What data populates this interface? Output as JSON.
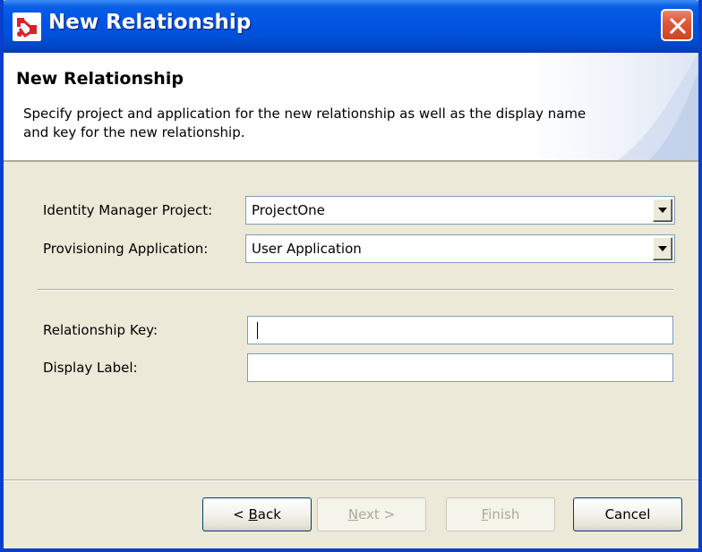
{
  "window": {
    "title": "New Relationship"
  },
  "banner": {
    "title": "New Relationship",
    "description": "Specify project and application for the new relationship as well as the display name and key for the new relationship."
  },
  "form": {
    "project_label": "Identity Manager Project:",
    "project_value": "ProjectOne",
    "application_label": "Provisioning Application:",
    "application_value": "User Application",
    "key_label": "Relationship Key:",
    "key_value": "",
    "display_label_label": "Display Label:",
    "display_label_value": ""
  },
  "buttons": {
    "back": {
      "pre": "< ",
      "mnemonic": "B",
      "rest": "ack"
    },
    "next": {
      "mnemonic": "N",
      "rest": "ext >"
    },
    "finish": {
      "mnemonic": "F",
      "rest": "inish"
    },
    "cancel": "Cancel"
  },
  "icons": {
    "app": "relationship-icon",
    "close": "close-icon",
    "dropdown": "dropdown-arrow-icon"
  },
  "colors": {
    "titlebar": "#0054e3",
    "close_button": "#e0573a",
    "dialog_background": "#ece9d8",
    "field_border": "#7f9db9"
  }
}
